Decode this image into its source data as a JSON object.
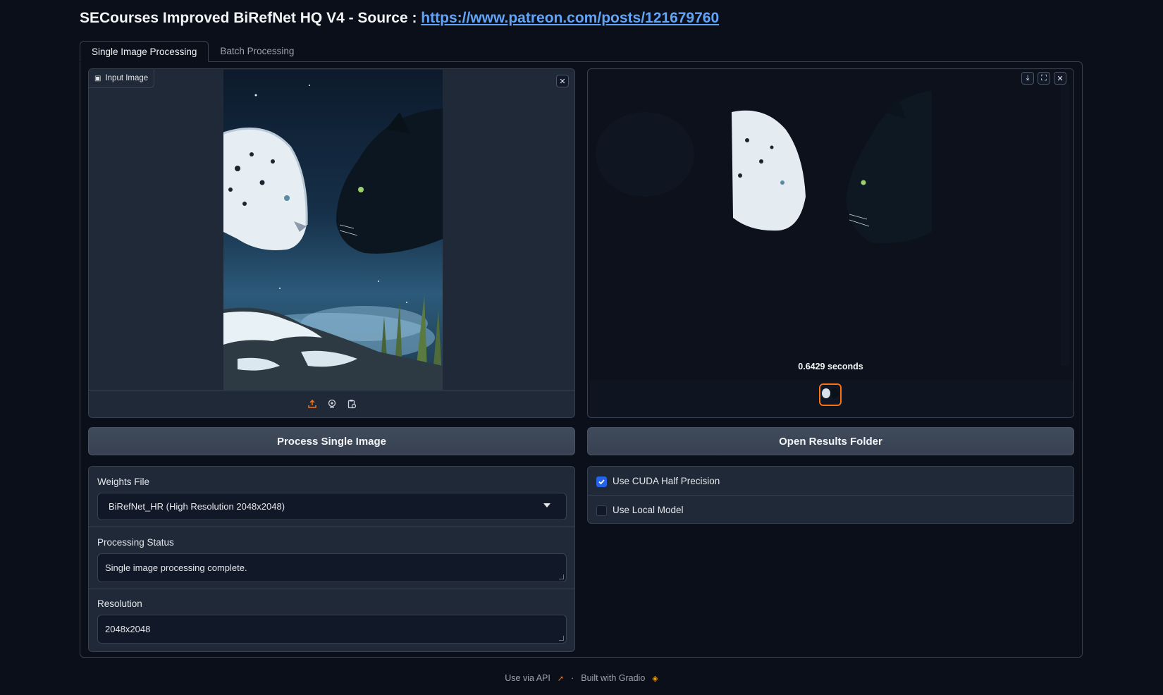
{
  "header": {
    "title_prefix": "SECourses Improved BiRefNet HQ V4 - Source : ",
    "source_link": "https://www.patreon.com/posts/121679760"
  },
  "tabs": [
    {
      "label": "Single Image Processing",
      "active": true
    },
    {
      "label": "Batch Processing",
      "active": false
    }
  ],
  "input_image": {
    "label": "Input Image",
    "source_icons": [
      "upload-icon",
      "webcam-icon",
      "clipboard-icon"
    ]
  },
  "output_gallery": {
    "caption": "0.6429 seconds",
    "toolbar_icons": [
      "download-icon",
      "fullscreen-icon",
      "close-icon"
    ]
  },
  "buttons": {
    "process": "Process Single Image",
    "open_folder": "Open Results Folder"
  },
  "weights": {
    "label": "Weights File",
    "value": "BiRefNet_HR (High Resolution 2048x2048)"
  },
  "status": {
    "label": "Processing Status",
    "value": "Single image processing complete."
  },
  "resolution": {
    "label": "Resolution",
    "value": "2048x2048"
  },
  "options": {
    "cuda_half": {
      "label": "Use CUDA Half Precision",
      "checked": true
    },
    "local_model": {
      "label": "Use Local Model",
      "checked": false
    }
  },
  "footer": {
    "api": "Use via API",
    "separator": "·",
    "built": "Built with Gradio"
  },
  "colors": {
    "background": "#0b0f19",
    "panel": "#1f2937",
    "border": "#374151",
    "accent": "#2563eb",
    "link": "#60a5fa",
    "orange": "#f97316"
  }
}
